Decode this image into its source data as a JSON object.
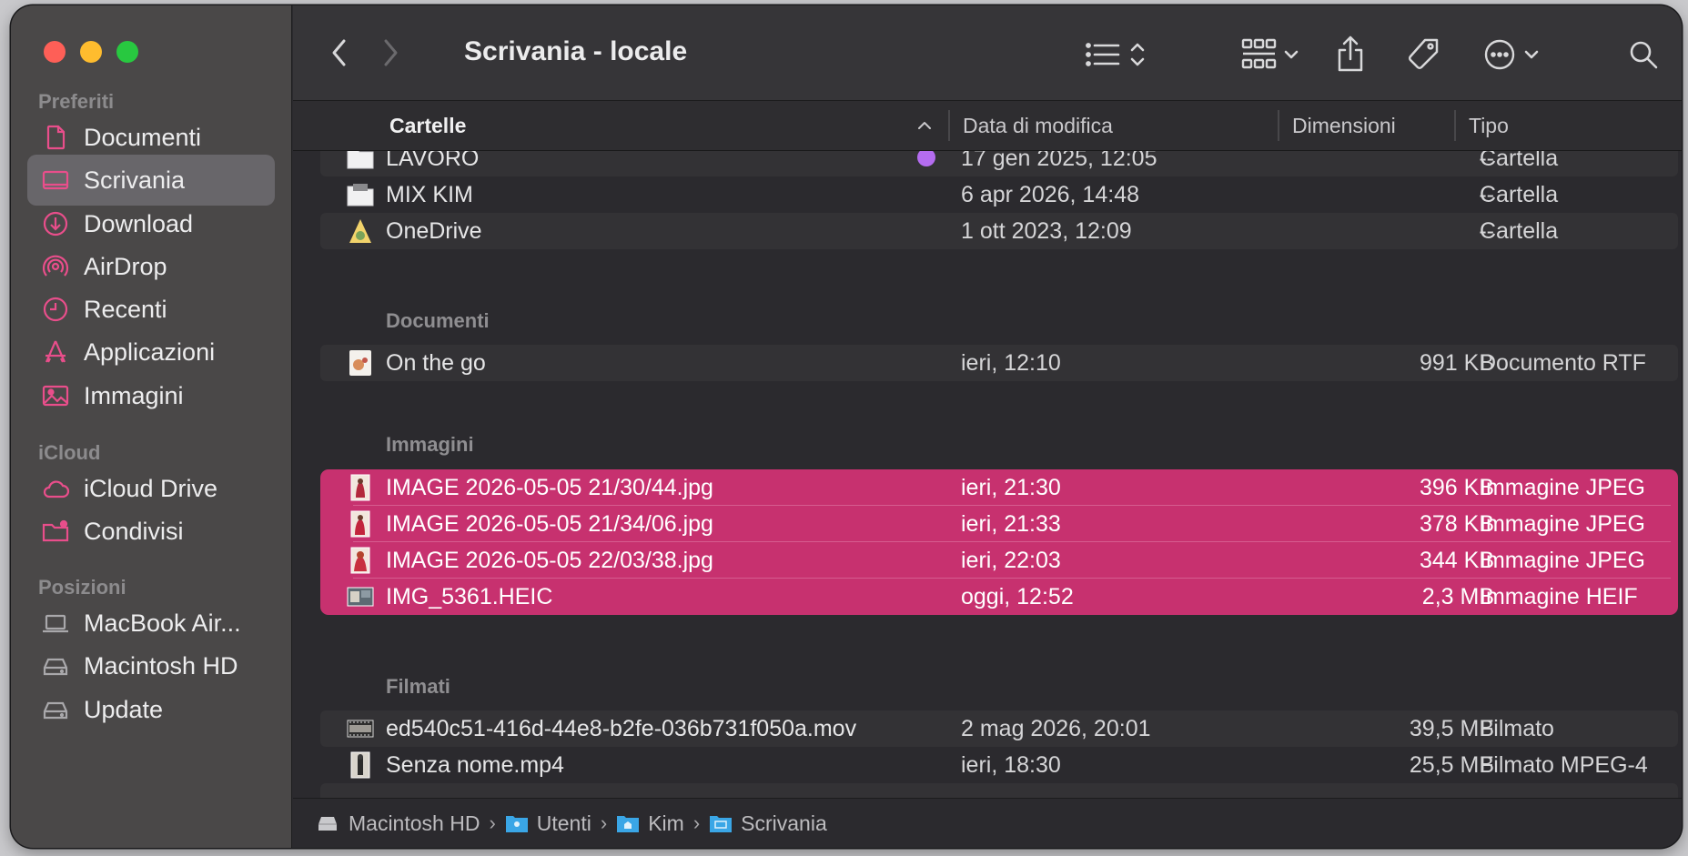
{
  "window": {
    "title": "Scrivania - locale"
  },
  "sidebar": {
    "sections": [
      {
        "label": "Preferiti"
      },
      {
        "label": "iCloud"
      },
      {
        "label": "Posizioni"
      }
    ],
    "items": [
      {
        "label": "Documenti",
        "icon": "document-icon"
      },
      {
        "label": "Scrivania",
        "icon": "desktop-icon",
        "selected": true
      },
      {
        "label": "Download",
        "icon": "download-icon"
      },
      {
        "label": "AirDrop",
        "icon": "airdrop-icon"
      },
      {
        "label": "Recenti",
        "icon": "clock-icon"
      },
      {
        "label": "Applicazioni",
        "icon": "applications-icon"
      },
      {
        "label": "Immagini",
        "icon": "photo-icon"
      },
      {
        "label": "iCloud Drive",
        "icon": "cloud-icon"
      },
      {
        "label": "Condivisi",
        "icon": "shared-folder-icon"
      },
      {
        "label": "MacBook Air...",
        "icon": "laptop-icon"
      },
      {
        "label": "Macintosh HD",
        "icon": "disk-icon"
      },
      {
        "label": "Update",
        "icon": "disk-icon"
      }
    ]
  },
  "columns": {
    "name": "Cartelle",
    "date": "Data di modifica",
    "size": "Dimensioni",
    "kind": "Tipo"
  },
  "groups": {
    "documenti": "Documenti",
    "immagini": "Immagini",
    "filmati": "Filmati"
  },
  "rows": [
    {
      "name": "LAVORO",
      "date": "17 gen 2025, 12:05",
      "size": "--",
      "kind": "Cartella",
      "icon": "folder-icon",
      "tag_color": "#b46cf0"
    },
    {
      "name": "MIX KIM",
      "date": "6 apr 2026, 14:48",
      "size": "--",
      "kind": "Cartella",
      "icon": "folder-icon"
    },
    {
      "name": "OneDrive",
      "date": "1 ott 2023, 12:09",
      "size": "--",
      "kind": "Cartella",
      "icon": "onedrive-folder-icon"
    },
    {
      "name": "On the go",
      "date": "ieri, 12:10",
      "size": "991 KB",
      "kind": "Documento RTF",
      "icon": "rtf-document-icon"
    },
    {
      "name": "IMAGE 2026-05-05 21/30/44.jpg",
      "date": "ieri, 21:30",
      "size": "396 KB",
      "kind": "Immagine JPEG",
      "icon": "image-thumbnail-icon",
      "selected": true
    },
    {
      "name": "IMAGE 2026-05-05 21/34/06.jpg",
      "date": "ieri, 21:33",
      "size": "378 KB",
      "kind": "Immagine JPEG",
      "icon": "image-thumbnail-icon",
      "selected": true
    },
    {
      "name": "IMAGE 2026-05-05 22/03/38.jpg",
      "date": "ieri, 22:03",
      "size": "344 KB",
      "kind": "Immagine JPEG",
      "icon": "image-thumbnail-icon",
      "selected": true
    },
    {
      "name": "IMG_5361.HEIC",
      "date": "oggi, 12:52",
      "size": "2,3 MB",
      "kind": "Immagine HEIF",
      "icon": "image-thumbnail-icon",
      "selected": true
    },
    {
      "name": "ed540c51-416d-44e8-b2fe-036b731f050a.mov",
      "date": "2 mag 2026, 20:01",
      "size": "39,5 MB",
      "kind": "Filmato",
      "icon": "video-thumbnail-icon"
    },
    {
      "name": "Senza nome.mp4",
      "date": "ieri, 18:30",
      "size": "25,5 MB",
      "kind": "Filmato MPEG-4",
      "icon": "video-thumbnail-icon"
    }
  ],
  "pathbar": {
    "crumbs": [
      "Macintosh HD",
      "Utenti",
      "Kim",
      "Scrivania"
    ],
    "separator": "›"
  },
  "colors": {
    "selection": "#c7316f",
    "sidebar_bg": "#4a4848",
    "accent_icon": "#e94e8b"
  }
}
